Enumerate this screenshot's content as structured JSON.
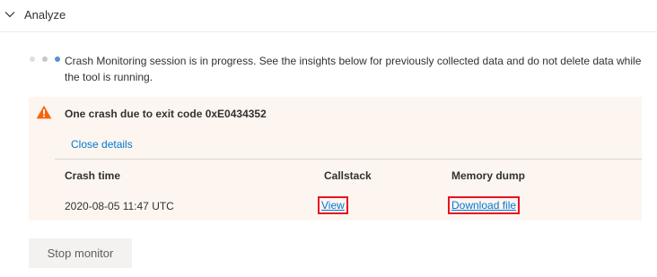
{
  "section": {
    "title": "Analyze",
    "icon": "chevron-down-icon",
    "expanded": true
  },
  "status": {
    "message": "Crash Monitoring session is in progress. See the insights below for previously collected data and do not delete data while the tool is running.",
    "icon": "progress-dots-icon"
  },
  "crash_panel": {
    "title": "One crash due to exit code 0xE0434352",
    "icon": "warning-icon",
    "close_details_label": "Close details",
    "columns": [
      "Crash time",
      "Callstack",
      "Memory dump"
    ],
    "rows": [
      {
        "crash_time": "2020-08-05 11:47 UTC",
        "callstack_link": "View",
        "memory_dump_link": "Download file"
      }
    ]
  },
  "actions": {
    "stop_monitor_label": "Stop monitor"
  },
  "colors": {
    "link": "#0078d4",
    "warning": "#f7630c",
    "panel_background": "#fdf6f0",
    "highlight_border": "#e81123",
    "button_background": "#f3f2f1"
  }
}
